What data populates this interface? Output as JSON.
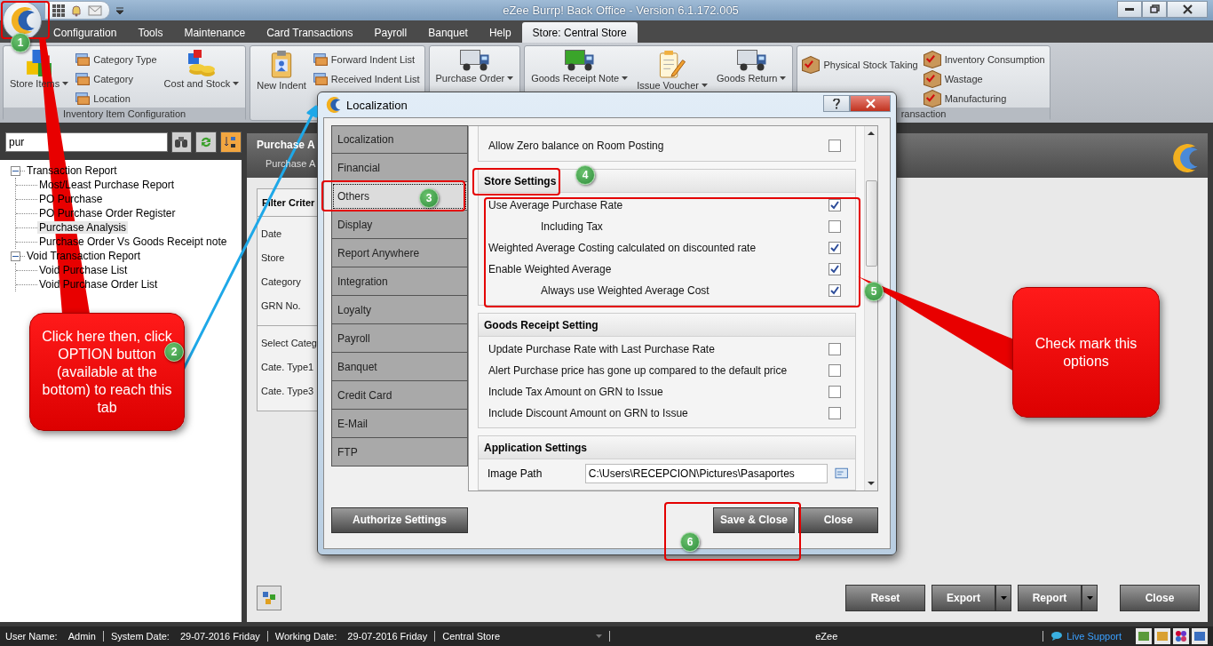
{
  "window": {
    "title": "eZee Burrp! Back Office - Version 6.1.172.005"
  },
  "menu_tabs": [
    {
      "label": "Configuration",
      "selected": false
    },
    {
      "label": "Tools",
      "selected": false
    },
    {
      "label": "Maintenance",
      "selected": false
    },
    {
      "label": "Card Transactions",
      "selected": false
    },
    {
      "label": "Payroll",
      "selected": false
    },
    {
      "label": "Banquet",
      "selected": false
    },
    {
      "label": "Help",
      "selected": false
    },
    {
      "label": "Store: Central Store",
      "selected": true
    }
  ],
  "ribbon": [
    {
      "label": "Inventory Item Configuration",
      "columns": [
        {
          "kind": "large",
          "label": "Store Items",
          "dropdown": true
        },
        {
          "kind": "stack",
          "items": [
            "Category Type",
            "Category",
            "Location"
          ]
        },
        {
          "kind": "large",
          "label": "Cost and Stock",
          "dropdown": true
        }
      ]
    },
    {
      "columns": [
        {
          "kind": "large",
          "label": "New Indent",
          "dropdown": false
        },
        {
          "kind": "stack",
          "items": [
            "Forward Indent List",
            "Received Indent List"
          ]
        }
      ]
    },
    {
      "columns": [
        {
          "kind": "large",
          "label": "Purchase Order",
          "dropdown": true
        }
      ]
    },
    {
      "columns": [
        {
          "kind": "large",
          "label": "Goods Receipt Note",
          "dropdown": true
        },
        {
          "kind": "large",
          "label": "Issue Voucher",
          "dropdown": true
        },
        {
          "kind": "large",
          "label": "Goods Return",
          "dropdown": true
        }
      ]
    },
    {
      "label": "ransaction",
      "columns": [
        {
          "kind": "stack",
          "items": [
            "Physical Stock Taking"
          ]
        },
        {
          "kind": "stack",
          "items": [
            "Inventory Consumption",
            "Wastage",
            "Manufacturing"
          ]
        }
      ]
    }
  ],
  "search": {
    "value": "pur"
  },
  "tool_buttons": [
    {
      "selected": false
    },
    {
      "selected": false
    },
    {
      "selected": true
    }
  ],
  "tree": [
    {
      "label": "Transaction Report",
      "expanded": true,
      "children": [
        {
          "label": "Most/Least Purchase Report",
          "selected": false
        },
        {
          "label": "PO Purchase",
          "selected": false
        },
        {
          "label": "PO Purchase Order Register",
          "selected": false
        },
        {
          "label": "Purchase Analysis",
          "selected": true
        },
        {
          "label": "Purchase Order Vs Goods Receipt note",
          "selected": false
        }
      ]
    },
    {
      "label": "Void Transaction Report",
      "expanded": true,
      "children": [
        {
          "label": "Void Purchase List",
          "selected": false
        },
        {
          "label": "Void Purchase Order List",
          "selected": false
        }
      ]
    }
  ],
  "report": {
    "title": "Purchase A",
    "subtitle": "Purchase A",
    "filter_heading": "Filter Criter",
    "fields": [
      "Date",
      "Store",
      "Category",
      "GRN No."
    ],
    "category_fields": [
      "Select Categ",
      "Cate. Type1",
      "Cate. Type3"
    ],
    "buttons": [
      {
        "label": "Reset",
        "dropdown": false
      },
      {
        "label": "Export",
        "dropdown": true
      },
      {
        "label": "Report",
        "dropdown": true
      },
      {
        "label": "Close",
        "dropdown": false
      }
    ]
  },
  "dialog": {
    "title": "Localization",
    "nav": [
      {
        "label": "Localization",
        "selected": false
      },
      {
        "label": "Financial",
        "selected": false
      },
      {
        "label": "Others",
        "selected": true
      },
      {
        "label": "Display",
        "selected": false
      },
      {
        "label": "Report Anywhere",
        "selected": false
      },
      {
        "label": "Integration",
        "selected": false
      },
      {
        "label": "Loyalty",
        "selected": false
      },
      {
        "label": "Payroll",
        "selected": false
      },
      {
        "label": "Banquet",
        "selected": false
      },
      {
        "label": "Credit Card",
        "selected": false
      },
      {
        "label": "E-Mail",
        "selected": false
      },
      {
        "label": "FTP",
        "selected": false
      }
    ],
    "sections": [
      {
        "rows": [
          {
            "label": "Allow Zero balance on Room Posting",
            "checked": false
          }
        ]
      },
      {
        "heading": "Store Settings",
        "rows": [
          {
            "label": "Use Average Purchase Rate",
            "checked": true,
            "children": [
              {
                "label": "Including Tax",
                "checked": false
              }
            ]
          },
          {
            "label": "Weighted Average Costing calculated on discounted rate",
            "checked": true
          },
          {
            "label": "Enable Weighted Average",
            "checked": true,
            "children": [
              {
                "label": "Always use Weighted Average Cost",
                "checked": true
              }
            ]
          }
        ]
      },
      {
        "heading": "Goods Receipt Setting",
        "rows": [
          {
            "label": "Update Purchase Rate with Last Purchase Rate",
            "checked": false
          },
          {
            "label": "Alert Purchase price has gone up compared to the default price",
            "checked": false
          },
          {
            "label": "Include Tax Amount on GRN to Issue",
            "checked": false
          },
          {
            "label": "Include Discount Amount on GRN to Issue",
            "checked": false
          }
        ]
      },
      {
        "heading": "Application Settings",
        "fields": [
          {
            "label": "Image Path",
            "value": "C:\\Users\\RECEPCION\\Pictures\\Pasaportes"
          }
        ]
      }
    ],
    "buttons": [
      "Authorize Settings",
      "Save & Close",
      "Close"
    ]
  },
  "status_bar": {
    "items": [
      {
        "label": "User Name:",
        "value": "Admin"
      },
      {
        "label": "System Date:",
        "value": "29-07-2016 Friday"
      },
      {
        "label": "Working Date:",
        "value": "29-07-2016 Friday"
      }
    ],
    "store": "Central Store",
    "center": "eZee",
    "link": "Live Support"
  },
  "annotations": {
    "markers": [
      "1",
      "2",
      "3",
      "4",
      "5",
      "6"
    ],
    "callouts": [
      "Click here then, click OPTION button (available at the bottom) to reach this tab",
      "Check mark this options"
    ]
  }
}
